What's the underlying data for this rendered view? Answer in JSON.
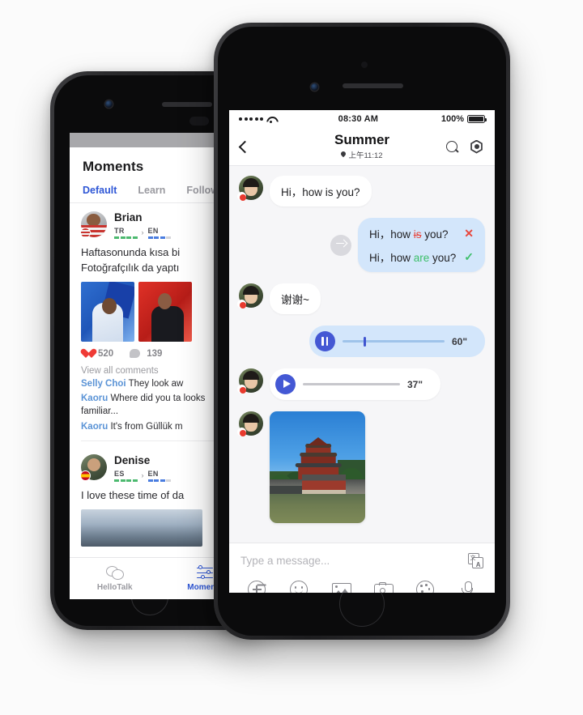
{
  "left_phone": {
    "app_title": "Moments",
    "tabs": [
      {
        "label": "Default",
        "active": true
      },
      {
        "label": "Learn",
        "active": false
      },
      {
        "label": "Follow",
        "active": false
      }
    ],
    "posts": [
      {
        "name": "Brian",
        "lang_from": "TR",
        "lang_arrow": "›",
        "lang_to": "EN",
        "text_line1": "Haftasonunda kısa bi",
        "text_line2": "Fotoğrafçılık da yaptı",
        "likes": "520",
        "comments_count": "139",
        "view_all": "View all comments",
        "comments": [
          {
            "user": "Selly Choi",
            "text": "They look aw"
          },
          {
            "user": "Kaoru",
            "text": "Where did you ta looks familiar..."
          },
          {
            "user": "Kaoru",
            "text": "It's from Güllük m"
          }
        ]
      },
      {
        "name": "Denise",
        "lang_from": "ES",
        "lang_arrow": "›",
        "lang_to": "EN",
        "text_line1": "I love these time of da"
      }
    ],
    "tabbar": [
      {
        "label": "HelloTalk",
        "icon": "chat-icon",
        "active": false
      },
      {
        "label": "Moments",
        "icon": "sliders-icon",
        "active": true
      }
    ]
  },
  "right_phone": {
    "status_bar": {
      "signal": "•••••",
      "wifi": "wifi-icon",
      "time": "08:30 AM",
      "battery_percent": "100%"
    },
    "header": {
      "back": "back-chevron",
      "name": "Summer",
      "location_time": "上午11:12",
      "search_icon": "search-icon",
      "settings_icon": "settings-hex-icon"
    },
    "messages": [
      {
        "type": "text",
        "side": "left",
        "text": "Hi，how is you?"
      },
      {
        "type": "correction",
        "side": "right",
        "share_icon": "share-arrow-icon",
        "original": {
          "pre": "Hi，how ",
          "wrong": "is",
          "post": " you?",
          "mark": "✕"
        },
        "corrected": {
          "pre": "Hi，how ",
          "right": "are",
          "post": " you?",
          "mark": "✓"
        }
      },
      {
        "type": "text",
        "side": "left",
        "text": "谢谢~"
      },
      {
        "type": "voice",
        "side": "right",
        "state": "playing",
        "duration": "60\""
      },
      {
        "type": "voice",
        "side": "left",
        "state": "paused",
        "duration": "37\""
      },
      {
        "type": "image",
        "side": "left",
        "alt": "forbidden-city-corner-tower-photo"
      }
    ],
    "input": {
      "placeholder": "Type a message...",
      "translate_icon": "translate-icon",
      "tools": [
        {
          "name": "add-icon"
        },
        {
          "name": "emoji-icon"
        },
        {
          "name": "gallery-icon"
        },
        {
          "name": "camera-icon"
        },
        {
          "name": "doodle-icon"
        },
        {
          "name": "microphone-icon"
        }
      ]
    }
  },
  "colors": {
    "accent_blue": "#2f57d6",
    "bubble_blue": "#d3e6fb",
    "error_red": "#e8463c",
    "success_green": "#3dbf6a",
    "voice_button": "#4458d4"
  }
}
